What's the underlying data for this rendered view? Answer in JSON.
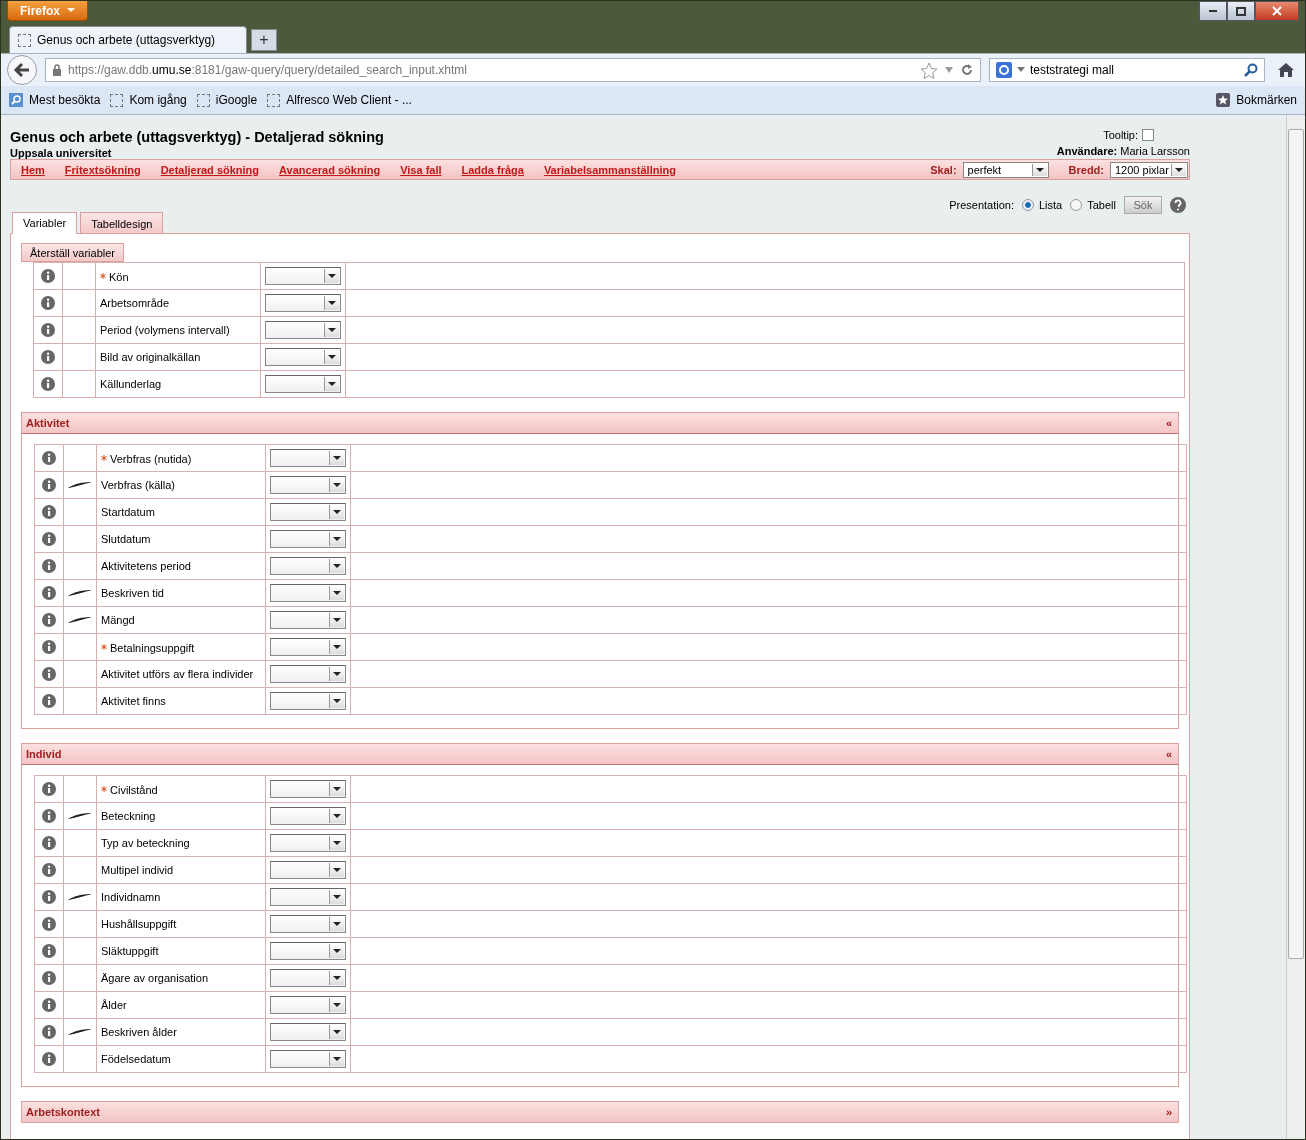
{
  "browser": {
    "menu_button": "Firefox",
    "tabs": [
      {
        "title": "Genus och arbete (uttagsverktyg)",
        "selected": true
      }
    ],
    "new_tab": "+",
    "url": {
      "prefix": "https://gaw.ddb.",
      "domain": "umu.se",
      "rest": ":8181/gaw-query/query/detailed_search_input.xhtml"
    },
    "search": "teststrategi mall",
    "bookmarks": [
      {
        "label": "Mest besökta",
        "kind": "search"
      },
      {
        "label": "Kom igång",
        "kind": "page"
      },
      {
        "label": "iGoogle",
        "kind": "page"
      },
      {
        "label": "Alfresco Web Client - ...",
        "kind": "page"
      }
    ],
    "bookmarks_menu": "Bokmärken"
  },
  "page": {
    "title": "Genus och arbete (uttagsverktyg) - Detaljerad sökning",
    "subtitle": "Uppsala universitet",
    "tooltip": {
      "label": "Tooltip:",
      "checked": false
    },
    "user": {
      "label": "Användare:",
      "name": "Maria Larsson"
    },
    "nav": [
      "Hem",
      "Fritextsökning",
      "Detaljerad sökning",
      "Avancerad sökning",
      "Visa fall",
      "Ladda fråga",
      "Variabelsammanställning"
    ],
    "scale": {
      "label": "Skal:",
      "value": "perfekt"
    },
    "width": {
      "label": "Bredd:",
      "value": "1200 pixlar"
    },
    "presentation": {
      "label": "Presentation:",
      "options": [
        {
          "label": "Lista",
          "selected": true
        },
        {
          "label": "Tabell",
          "selected": false
        }
      ],
      "button": "Sök"
    },
    "tabs": [
      {
        "label": "Variabler",
        "selected": true
      },
      {
        "label": "Tabelldesign",
        "selected": false
      }
    ],
    "reset_button": "Återställ variabler",
    "general_rows": [
      {
        "label": "Kön",
        "required": true,
        "source": false
      },
      {
        "label": "Arbetsområde",
        "required": false,
        "source": false
      },
      {
        "label": "Period (volymens intervall)",
        "required": false,
        "source": false
      },
      {
        "label": "Bild av originalkällan",
        "required": false,
        "source": false
      },
      {
        "label": "Källunderlag",
        "required": false,
        "source": false
      }
    ],
    "sections": [
      {
        "title": "Aktivitet",
        "toggle": "«",
        "expanded": true,
        "rows": [
          {
            "label": "Verbfras (nutida)",
            "required": true,
            "source": false
          },
          {
            "label": "Verbfras (källa)",
            "required": false,
            "source": true
          },
          {
            "label": "Startdatum",
            "required": false,
            "source": false
          },
          {
            "label": "Slutdatum",
            "required": false,
            "source": false
          },
          {
            "label": "Aktivitetens period",
            "required": false,
            "source": false
          },
          {
            "label": "Beskriven tid",
            "required": false,
            "source": true
          },
          {
            "label": "Mängd",
            "required": false,
            "source": true
          },
          {
            "label": "Betalningsuppgift",
            "required": true,
            "source": false
          },
          {
            "label": "Aktivitet utförs av flera individer",
            "required": false,
            "source": false
          },
          {
            "label": "Aktivitet finns",
            "required": false,
            "source": false
          }
        ]
      },
      {
        "title": "Individ",
        "toggle": "«",
        "expanded": true,
        "rows": [
          {
            "label": "Civilstånd",
            "required": true,
            "source": false
          },
          {
            "label": "Beteckning",
            "required": false,
            "source": true
          },
          {
            "label": "Typ av beteckning",
            "required": false,
            "source": false
          },
          {
            "label": "Multipel individ",
            "required": false,
            "source": false
          },
          {
            "label": "Individnamn",
            "required": false,
            "source": true
          },
          {
            "label": "Hushållsuppgift",
            "required": false,
            "source": false
          },
          {
            "label": "Släktuppgift",
            "required": false,
            "source": false
          },
          {
            "label": "Ägare av organisation",
            "required": false,
            "source": false
          },
          {
            "label": "Ålder",
            "required": false,
            "source": false
          },
          {
            "label": "Beskriven ålder",
            "required": false,
            "source": true
          },
          {
            "label": "Födelsedatum",
            "required": false,
            "source": false
          }
        ]
      },
      {
        "title": "Arbetskontext",
        "toggle": "»",
        "expanded": false
      }
    ]
  }
}
